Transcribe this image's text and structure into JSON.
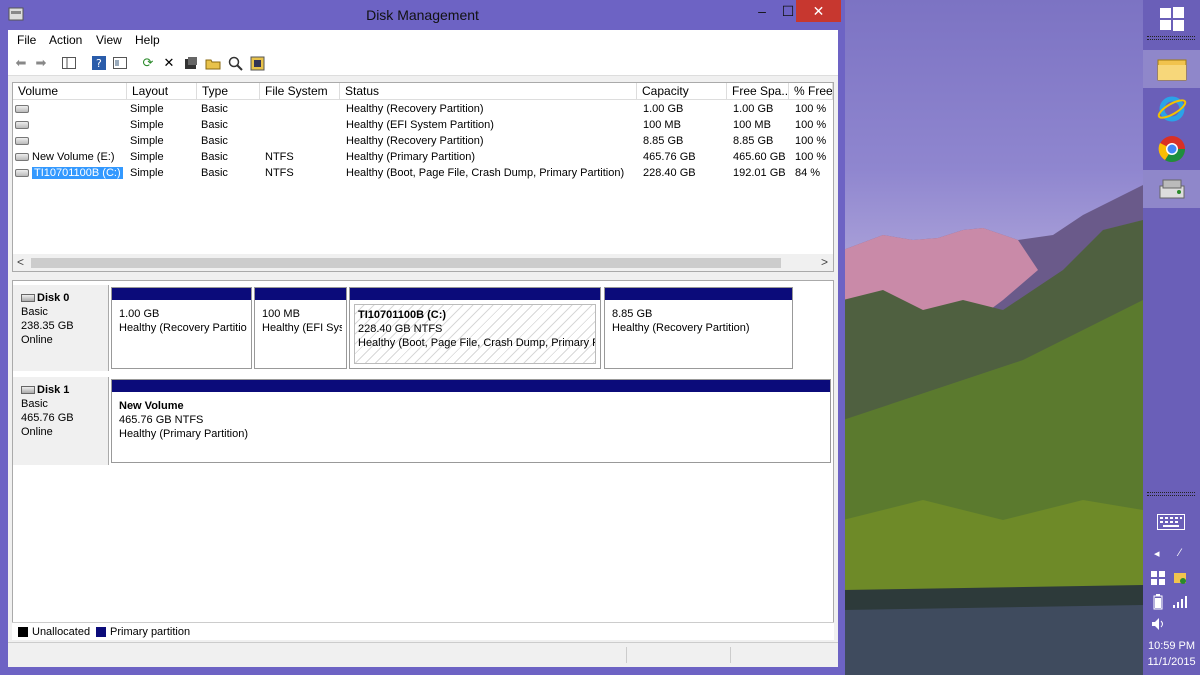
{
  "window": {
    "title": "Disk Management",
    "buttons": {
      "minimize": "–",
      "maximize": "☐",
      "close": "✕"
    }
  },
  "menu": [
    "File",
    "Action",
    "View",
    "Help"
  ],
  "toolbar": {
    "icons": [
      "back-arrow-icon",
      "forward-arrow-icon",
      "console-tree-icon",
      "help-icon",
      "properties-icon",
      "refresh-icon",
      "delete-icon",
      "properties-sheet-icon",
      "open-folder-icon",
      "search-icon",
      "explore-icon"
    ]
  },
  "volume_list": {
    "columns": [
      "Volume",
      "Layout",
      "Type",
      "File System",
      "Status",
      "Capacity",
      "Free Spa...",
      "% Free"
    ],
    "rows": [
      {
        "volume": "",
        "layout": "Simple",
        "type": "Basic",
        "fs": "",
        "status": "Healthy (Recovery Partition)",
        "capacity": "1.00 GB",
        "free": "1.00 GB",
        "pct": "100 %"
      },
      {
        "volume": "",
        "layout": "Simple",
        "type": "Basic",
        "fs": "",
        "status": "Healthy (EFI System Partition)",
        "capacity": "100 MB",
        "free": "100 MB",
        "pct": "100 %"
      },
      {
        "volume": "",
        "layout": "Simple",
        "type": "Basic",
        "fs": "",
        "status": "Healthy (Recovery Partition)",
        "capacity": "8.85 GB",
        "free": "8.85 GB",
        "pct": "100 %"
      },
      {
        "volume": "New Volume (E:)",
        "layout": "Simple",
        "type": "Basic",
        "fs": "NTFS",
        "status": "Healthy (Primary Partition)",
        "capacity": "465.76 GB",
        "free": "465.60 GB",
        "pct": "100 %"
      },
      {
        "volume": "TI10701100B (C:)",
        "layout": "Simple",
        "type": "Basic",
        "fs": "NTFS",
        "status": "Healthy (Boot, Page File, Crash Dump, Primary Partition)",
        "capacity": "228.40 GB",
        "free": "192.01 GB",
        "pct": "84 %"
      }
    ],
    "scroll_left": "<",
    "scroll_right": ">"
  },
  "disks": [
    {
      "name": "Disk 0",
      "type": "Basic",
      "size": "238.35 GB",
      "status": "Online",
      "partitions": [
        {
          "title": "",
          "size": "1.00 GB",
          "status": "Healthy (Recovery Partitio"
        },
        {
          "title": "",
          "size": "100 MB",
          "status": "Healthy (EFI Syst"
        },
        {
          "title": "TI10701100B  (C:)",
          "size": "228.40 GB NTFS",
          "status": "Healthy (Boot, Page File, Crash Dump, Primary P"
        },
        {
          "title": "",
          "size": "8.85 GB",
          "status": "Healthy (Recovery Partition)"
        }
      ]
    },
    {
      "name": "Disk 1",
      "type": "Basic",
      "size": "465.76 GB",
      "status": "Online",
      "partitions": [
        {
          "title": "New Volume",
          "size": "465.76 GB NTFS",
          "status": "Healthy (Primary Partition)"
        }
      ]
    }
  ],
  "legend": [
    {
      "label": "Unallocated",
      "color": "#000000"
    },
    {
      "label": "Primary partition",
      "color": "#0b0b7a"
    }
  ],
  "taskbar": {
    "clock_time": "10:59 PM",
    "clock_date": "11/1/2015",
    "apps": [
      "file-explorer-icon",
      "internet-explorer-icon",
      "chrome-icon",
      "disk-management-icon"
    ]
  }
}
